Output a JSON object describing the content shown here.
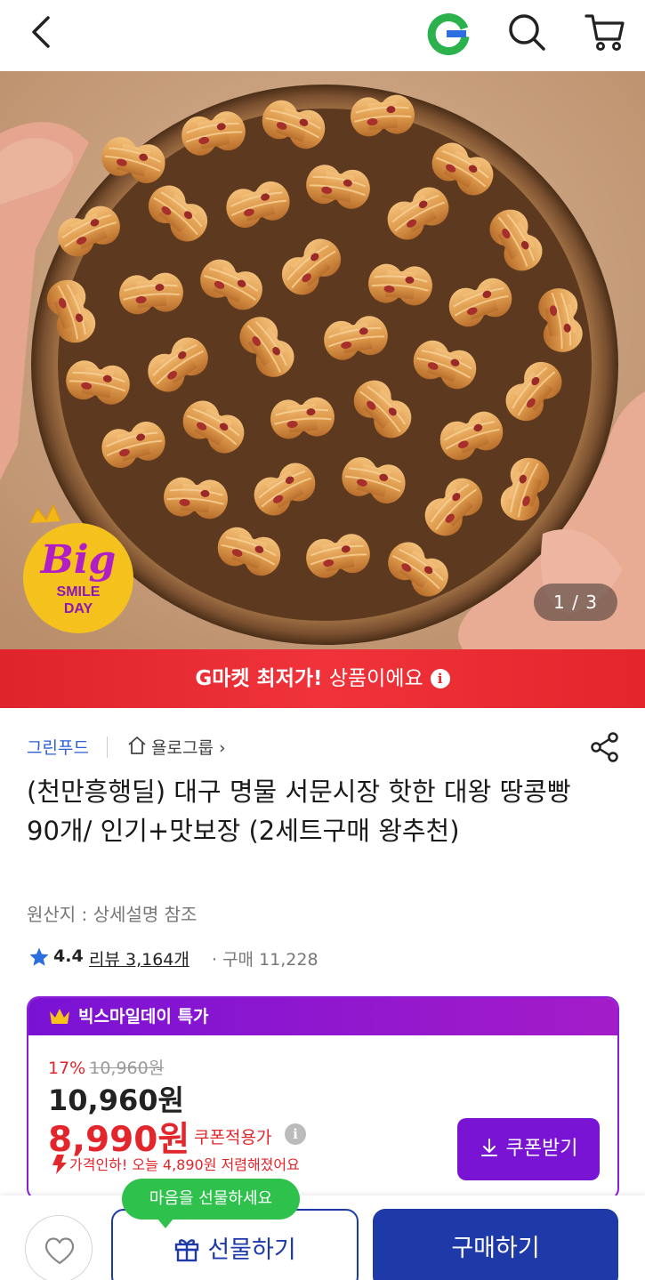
{
  "header": {
    "back_icon": "chevron-left-icon",
    "logo_letter": "G",
    "search_icon": "search-icon",
    "cart_icon": "cart-icon"
  },
  "hero": {
    "image_counter": "1 / 3",
    "badge": {
      "big": "Big",
      "smile": "SMILE",
      "day": "DAY"
    }
  },
  "banner": {
    "bold": "G마켓 최저가!",
    "rest": " 상품이에요",
    "info_icon": "i"
  },
  "product": {
    "seller": "그린푸드",
    "group": "욜로그룹",
    "title": "(천만흥행딜) 대구 명물 서문시장 핫한 대왕 땅콩빵 90개/ 인기+맛보장 (2세트구매 왕추천)",
    "origin": "원산지 : 상세설명 참조",
    "rating": "4.4",
    "reviews": "리뷰 3,164개",
    "purchases": "· 구매 11,228"
  },
  "price": {
    "event_label": "빅스마일데이 특가",
    "discount_pct": "17%",
    "original": "10,960원",
    "price": "10,960원",
    "sale_price": "8,990원",
    "coupon_label": "쿠폰적용가",
    "drop_text": "가격인하! 오늘 4,890원 저렴해졌어요",
    "coupon_button": "쿠폰받기"
  },
  "bottom": {
    "gift_tooltip": "마음을 선물하세요",
    "gift_button": "선물하기",
    "buy_button": "구매하기"
  },
  "colors": {
    "brand_blue": "#1e3aa8",
    "sale_red": "#e2262c",
    "event_purple": "#7a14d4",
    "gmarket_green": "#2bb24c"
  }
}
